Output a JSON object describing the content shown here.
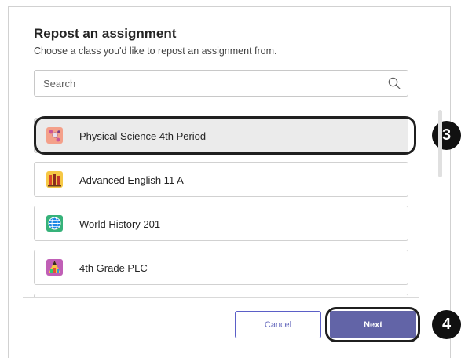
{
  "dialog": {
    "title": "Repost an assignment",
    "subtitle": "Choose a class you'd like to repost an assignment from."
  },
  "search": {
    "placeholder": "Search",
    "value": "",
    "icon": "search-icon"
  },
  "classes": [
    {
      "label": "Physical Science 4th Period",
      "icon": "molecule-icon",
      "color": "#f4a08a",
      "selected": true
    },
    {
      "label": "Advanced English 11 A",
      "icon": "books-icon",
      "color": "#f6c845",
      "selected": false
    },
    {
      "label": "World History 201",
      "icon": "globe-icon",
      "color": "#36b27a",
      "selected": false
    },
    {
      "label": "4th Grade PLC",
      "icon": "pencils-icon",
      "color": "#c05fb6",
      "selected": false
    }
  ],
  "footer": {
    "cancel_label": "Cancel",
    "next_label": "Next"
  },
  "annotations": {
    "step_select": "3",
    "step_next": "4"
  },
  "colors": {
    "accent": "#6264a7",
    "selected_bg": "#ebebeb",
    "badge": "#111111"
  }
}
